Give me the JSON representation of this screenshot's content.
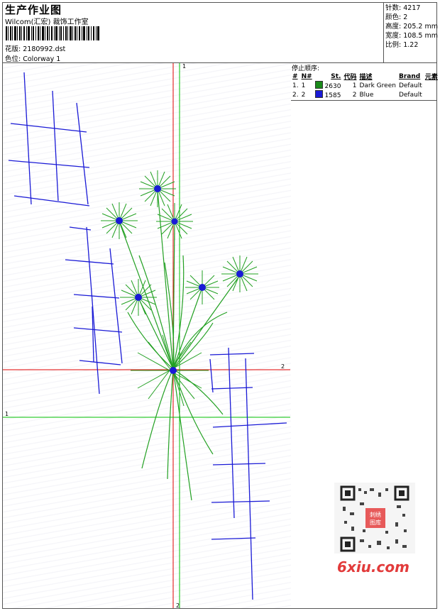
{
  "header": {
    "title": "生产作业图",
    "studio": "Wilcom(汇宏) 裁饰工作室",
    "design_label": "花版:",
    "design_file": "2180992.dst",
    "colorway_label": "色位:",
    "colorway": "Colorway 1"
  },
  "stats": [
    {
      "label": "针数:",
      "value": "4217"
    },
    {
      "label": "颜色:",
      "value": "2"
    },
    {
      "label": "高度:",
      "value": "205.2 mm"
    },
    {
      "label": "宽度:",
      "value": "108.5 mm"
    },
    {
      "label": "比例:",
      "value": "1.22"
    }
  ],
  "stop_sequence": {
    "title": "停止顺序:",
    "columns": [
      "#",
      "N#",
      "St.",
      "代码",
      "描述",
      "Brand",
      "元素"
    ],
    "rows": [
      {
        "idx": "1.",
        "n": "1",
        "stitches": "2630",
        "code": "1",
        "desc": "Dark Green",
        "brand": "Default",
        "color": "#1a8a1a"
      },
      {
        "idx": "2.",
        "n": "2",
        "stitches": "1585",
        "code": "2",
        "desc": "Blue",
        "brand": "Default",
        "color": "#1a1ad6"
      }
    ]
  },
  "axis_labels": {
    "top_green": "1",
    "left_green": "1",
    "right_red": "2",
    "bottom_red": "2"
  },
  "watermark": {
    "logo_text": "6xiu.com",
    "qr_badge": "刺绣图库"
  },
  "colors": {
    "thread_green": "#22a022",
    "thread_blue": "#1a1ad6",
    "axis_red": "#e00000",
    "axis_green": "#00c000"
  }
}
